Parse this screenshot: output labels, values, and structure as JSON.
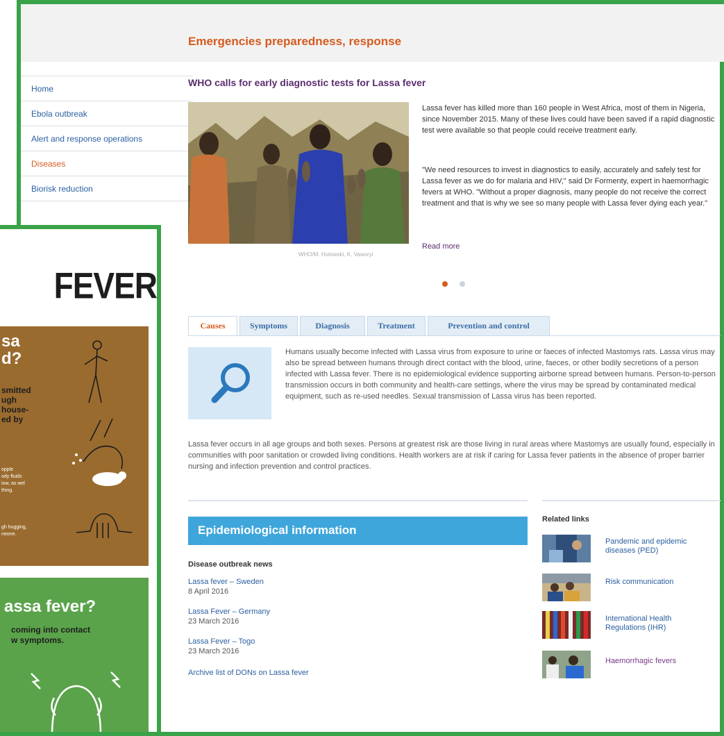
{
  "site": {
    "title": "Emergencies preparedness, response"
  },
  "nav": {
    "items": [
      {
        "label": "Home"
      },
      {
        "label": "Ebola outbreak"
      },
      {
        "label": "Alert and response operations"
      },
      {
        "label": "Diseases"
      },
      {
        "label": "Biorisk reduction"
      }
    ]
  },
  "feature": {
    "headline": "WHO calls for early diagnostic tests for Lassa fever",
    "caption": "WHO/M. Hotowski, K. Vaworyi",
    "para1": "Lassa fever has killed more than 160 people in West Africa, most of them in Nigeria, since November 2015. Many of these lives could have been saved if a rapid diagnostic test were available so that people could receive treatment early.",
    "para2": "\"We need resources to invest in diagnostics to easily, accurately and safely test for Lassa fever as we do for malaria and HIV,\" said Dr Formenty, expert in haemorrhagic fevers at WHO. \"Without a proper diagnosis, many people do not receive the correct treatment and that is why we see so many people with Lassa fever dying each year.\"",
    "read_more": "Read more"
  },
  "colors": {
    "accent": "#d65b1e",
    "frame": "#3aa349",
    "link": "#2a5fa0",
    "epi": "#3fa6dc"
  },
  "tabs": [
    {
      "label": "Causes"
    },
    {
      "label": "Symptoms"
    },
    {
      "label": "Diagnosis"
    },
    {
      "label": "Treatment"
    },
    {
      "label": "Prevention and control"
    }
  ],
  "causes": {
    "icon": "magnifier-icon",
    "text1": "Humans usually become infected with Lassa virus from exposure to urine or faeces of infected Mastomys rats. Lassa virus may also be spread between humans through direct contact with the blood, urine, faeces, or other bodily secretions of a person infected with Lassa fever. There is no epidemiological evidence supporting airborne spread between humans. Person-to-person transmission occurs in both community and health-care settings, where the virus may be spread by contaminated medical equipment, such as re-used needles. Sexual transmission of Lassa virus has been reported.",
    "text2": "Lassa fever occurs in all age groups and both sexes. Persons at greatest risk are those living in rural areas where Mastomys are usually found, especially in communities with poor sanitation or crowded living conditions. Health workers are at risk if caring for Lassa fever patients in the absence of proper barrier nursing and infection prevention and control practices."
  },
  "epi": {
    "title": "Epidemiological information",
    "subtitle": "Disease outbreak news",
    "items": [
      {
        "title": "Lassa fever – Sweden",
        "date": "8 April 2016"
      },
      {
        "title": "Lassa Fever – Germany",
        "date": "23 March 2016"
      },
      {
        "title": "Lassa Fever – Togo",
        "date": "23 March 2016"
      }
    ],
    "archive": "Archive list of DONs on Lassa fever"
  },
  "related": {
    "title": "Related links",
    "items": [
      {
        "label": "Pandemic and epidemic diseases (PED)"
      },
      {
        "label": "Risk communication"
      },
      {
        "label": "International Health Regulations (IHR)"
      },
      {
        "label": "Haemorrhagic fevers"
      }
    ]
  },
  "poster": {
    "title": "FEVER",
    "q1a": "sa",
    "q1b": "d?",
    "text1": [
      "smitted",
      "ugh",
      "house-",
      "ed by"
    ],
    "small1": [
      "opple",
      "ody fluids",
      "iow, as wel",
      "thing."
    ],
    "small2": [
      "gh hugging,",
      "neone."
    ],
    "q2": "assa fever?",
    "text2": [
      "coming into contact",
      "w symptoms."
    ]
  }
}
